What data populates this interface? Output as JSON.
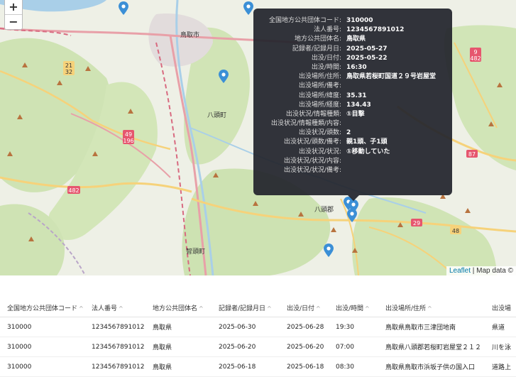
{
  "map": {
    "zoom_in": "+",
    "zoom_out": "−",
    "attribution_link": "Leaflet",
    "attribution_text": " | Map data ©",
    "place_labels": [
      "鳥取市",
      "八頭町",
      "智頭町",
      "八頭郡"
    ],
    "route_labels": [
      "9",
      "482",
      "21",
      "32",
      "49",
      "196",
      "482",
      "87",
      "29",
      "48"
    ],
    "colors": {
      "land": "#eef0e6",
      "forest": "#cfe3b4",
      "road_major": "#e8a0a8",
      "road_minor": "#f6d27a",
      "water": "#a9cfe8",
      "marker": "#3b8fd6"
    }
  },
  "tooltip": {
    "rows": [
      {
        "key": "全国地方公共団体コード:",
        "value": "310000"
      },
      {
        "key": "法人番号:",
        "value": "1234567891012"
      },
      {
        "key": "地方公共団体名:",
        "value": "鳥取県"
      },
      {
        "key": "記録者/記録月日:",
        "value": "2025-05-27"
      },
      {
        "key": "出没/日付:",
        "value": "2025-05-22"
      },
      {
        "key": "出没/時間:",
        "value": "16:30"
      },
      {
        "key": "出没場所/住所:",
        "value": "鳥取県若桜町国道２９号岩屋堂"
      },
      {
        "key": "出没場所/備考:",
        "value": ""
      },
      {
        "key": "出没場所/緯度:",
        "value": "35.31"
      },
      {
        "key": "出没場所/経度:",
        "value": "134.43"
      },
      {
        "key": "出没状況/情報種類:",
        "value": "①目撃"
      },
      {
        "key": "出没状況/情報種類/内容:",
        "value": ""
      },
      {
        "key": "出没状況/頭数:",
        "value": "2"
      },
      {
        "key": "出没状況/頭数/備考:",
        "value": "親1頭、子1頭"
      },
      {
        "key": "出没状況/状況:",
        "value": "①移動していた"
      },
      {
        "key": "出没状況/状況/内容:",
        "value": ""
      },
      {
        "key": "出没状況/状況/備考:",
        "value": ""
      }
    ]
  },
  "table": {
    "headers": [
      "全国地方公共団体コード",
      "法人番号",
      "地方公共団体名",
      "記録者/記録月日",
      "出没/日付",
      "出没/時間",
      "出没場所/住所",
      "出没場"
    ],
    "sort_icon": "^",
    "rows": [
      [
        "310000",
        "1234567891012",
        "鳥取県",
        "2025-06-30",
        "2025-06-28",
        "19:30",
        "鳥取県鳥取市三津団地南",
        "県道"
      ],
      [
        "310000",
        "1234567891012",
        "鳥取県",
        "2025-06-20",
        "2025-06-20",
        "07:00",
        "鳥取県八頭郡若桜町岩屋堂２１２",
        "川を泳"
      ],
      [
        "310000",
        "1234567891012",
        "鳥取県",
        "2025-06-18",
        "2025-06-18",
        "08:30",
        "鳥取県鳥取市浜坂子供の国入口",
        "道路上"
      ]
    ]
  }
}
